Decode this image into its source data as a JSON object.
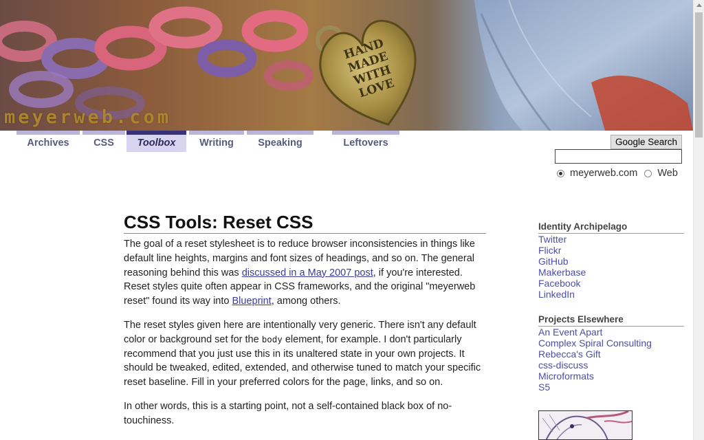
{
  "banner": {
    "logo_text": "meyerweb.com",
    "pendant_text": "HAND MADE WITH LOVE"
  },
  "nav": {
    "items": [
      {
        "label": "Archives"
      },
      {
        "label": "CSS"
      },
      {
        "label": "Toolbox",
        "active": true
      },
      {
        "label": "Writing"
      },
      {
        "label": "Speaking"
      },
      {
        "label": "Leftovers"
      }
    ]
  },
  "search": {
    "button_label": "Google Search",
    "input_value": "",
    "options": [
      {
        "label": "meyerweb.com",
        "checked": true
      },
      {
        "label": "Web",
        "checked": false
      }
    ]
  },
  "article": {
    "title": "CSS Tools: Reset CSS",
    "p1_a": "The goal of a reset stylesheet is to reduce browser inconsistencies in things like default line heights, margins and font sizes of headings, and so on. The general reasoning behind this was ",
    "p1_link1": "discussed in a May 2007 post",
    "p1_b": ", if you're interested. Reset styles quite often appear in CSS frameworks, and the original \"meyerweb reset\" found its way into ",
    "p1_link2": "Blueprint",
    "p1_c": ", among others.",
    "p2_a": "The reset styles given here are intentionally very generic. There isn't any default color or background set for the ",
    "p2_code": "body",
    "p2_b": " element, for example. I don't particularly recommend that you just use this in its unaltered state in your own projects. It should be tweaked, edited, extended, and otherwise tuned to match your specific reset baseline. Fill in your preferred colors for the page, links, and so on.",
    "p3": "In other words, this is a starting point, not a self-contained black box of no-touchiness."
  },
  "sidebar": {
    "identity": {
      "heading": "Identity Archipelago",
      "links": [
        "Twitter",
        "Flickr",
        "GitHub",
        "Makerbase",
        "Facebook",
        "LinkedIn"
      ]
    },
    "projects": {
      "heading": "Projects Elsewhere",
      "links": [
        "An Event Apart",
        "Complex Spiral Consulting",
        "Rebecca's Gift",
        "css-discuss",
        "Microformats",
        "S5"
      ]
    }
  },
  "colors": {
    "nav_active_bg": "#d8d4f0",
    "nav_active_border": "#3a3278",
    "nav_border": "#b9b6d9",
    "link": "#4b4fa5"
  }
}
